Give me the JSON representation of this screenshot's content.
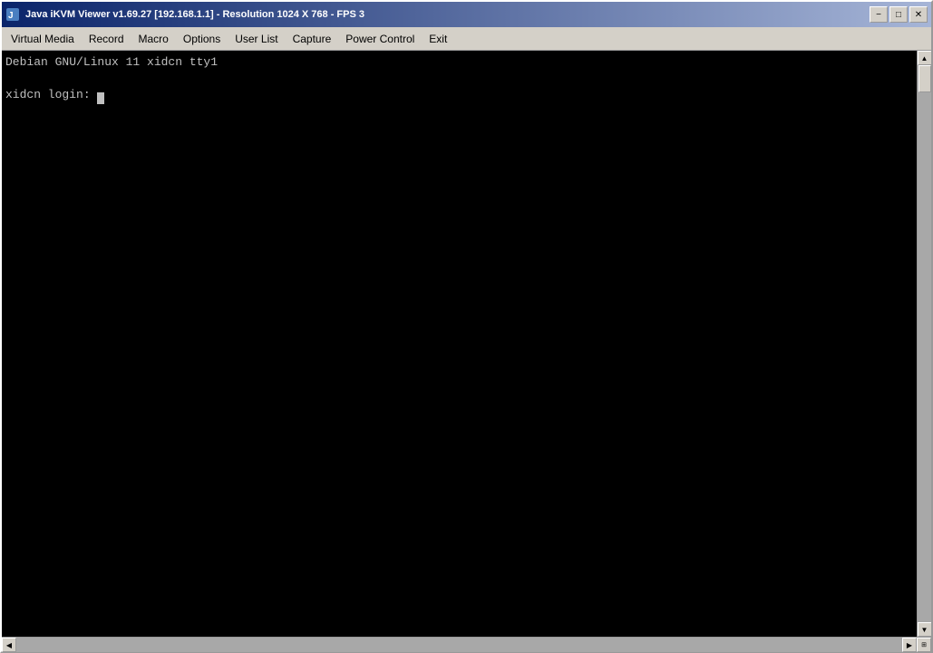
{
  "window": {
    "title": "Java iKVM Viewer v1.69.27 [192.168.1.1] - Resolution 1024 X 768 - FPS 3"
  },
  "menu": {
    "items": [
      {
        "label": "Virtual Media"
      },
      {
        "label": "Record"
      },
      {
        "label": "Macro"
      },
      {
        "label": "Options"
      },
      {
        "label": "User List"
      },
      {
        "label": "Capture"
      },
      {
        "label": "Power Control"
      },
      {
        "label": "Exit"
      }
    ]
  },
  "terminal": {
    "line1": "Debian GNU/Linux 11 xidcn tty1",
    "line2": "",
    "line3": "xidcn login: "
  },
  "titlebar": {
    "minimize": "−",
    "restore": "□",
    "close": "✕"
  }
}
